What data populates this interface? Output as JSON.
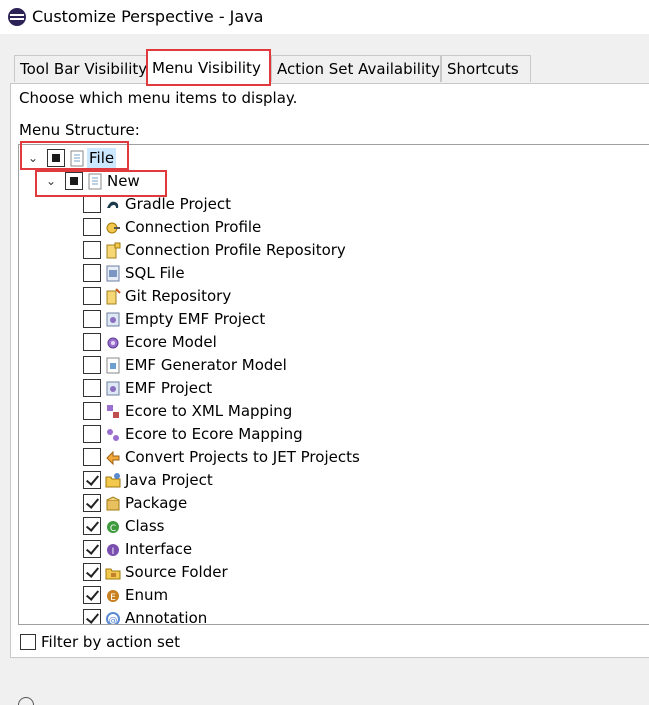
{
  "window": {
    "title": "Customize Perspective - Java",
    "app_icon": "eclipse-icon"
  },
  "tabs": [
    {
      "label": "Tool Bar Visibility",
      "active": false
    },
    {
      "label": "Menu Visibility",
      "active": true
    },
    {
      "label": "Action Set Availability",
      "active": false
    },
    {
      "label": "Shortcuts",
      "active": false
    }
  ],
  "panel": {
    "description": "Choose which menu items to display.",
    "structure_label": "Menu Structure:"
  },
  "tree": {
    "file": {
      "label": "File",
      "state": "partial",
      "expanded": true,
      "icon": "menu-page-icon"
    },
    "new": {
      "label": "New",
      "state": "partial",
      "expanded": true,
      "icon": "menu-page-icon"
    },
    "items": [
      {
        "label": "Gradle Project",
        "checked": false,
        "icon": "gradle-icon"
      },
      {
        "label": "Connection Profile",
        "checked": false,
        "icon": "connection-profile-icon"
      },
      {
        "label": "Connection Profile Repository",
        "checked": false,
        "icon": "repository-icon"
      },
      {
        "label": "SQL File",
        "checked": false,
        "icon": "sql-file-icon"
      },
      {
        "label": "Git Repository",
        "checked": false,
        "icon": "git-repository-icon"
      },
      {
        "label": "Empty EMF Project",
        "checked": false,
        "icon": "emf-project-icon"
      },
      {
        "label": "Ecore Model",
        "checked": false,
        "icon": "ecore-model-icon"
      },
      {
        "label": "EMF Generator Model",
        "checked": false,
        "icon": "emf-generator-icon"
      },
      {
        "label": "EMF Project",
        "checked": false,
        "icon": "emf-project-icon"
      },
      {
        "label": "Ecore to XML Mapping",
        "checked": false,
        "icon": "ecore-xml-mapping-icon"
      },
      {
        "label": "Ecore to Ecore Mapping",
        "checked": false,
        "icon": "ecore-mapping-icon"
      },
      {
        "label": "Convert Projects to JET Projects",
        "checked": false,
        "icon": "convert-icon"
      },
      {
        "label": "Java Project",
        "checked": true,
        "icon": "java-project-icon"
      },
      {
        "label": "Package",
        "checked": true,
        "icon": "package-icon"
      },
      {
        "label": "Class",
        "checked": true,
        "icon": "class-icon"
      },
      {
        "label": "Interface",
        "checked": true,
        "icon": "interface-icon"
      },
      {
        "label": "Source Folder",
        "checked": true,
        "icon": "source-folder-icon"
      },
      {
        "label": "Enum",
        "checked": true,
        "icon": "enum-icon"
      },
      {
        "label": "Annotation",
        "checked": true,
        "icon": "annotation-icon"
      }
    ]
  },
  "filter": {
    "label": "Filter by action set",
    "checked": false
  },
  "colors": {
    "highlight": "#e0393e",
    "selection": "#cce8ff",
    "class_green": "#3d9b3d",
    "interface_purple": "#7b4fb0",
    "enum_orange": "#c8801e"
  }
}
